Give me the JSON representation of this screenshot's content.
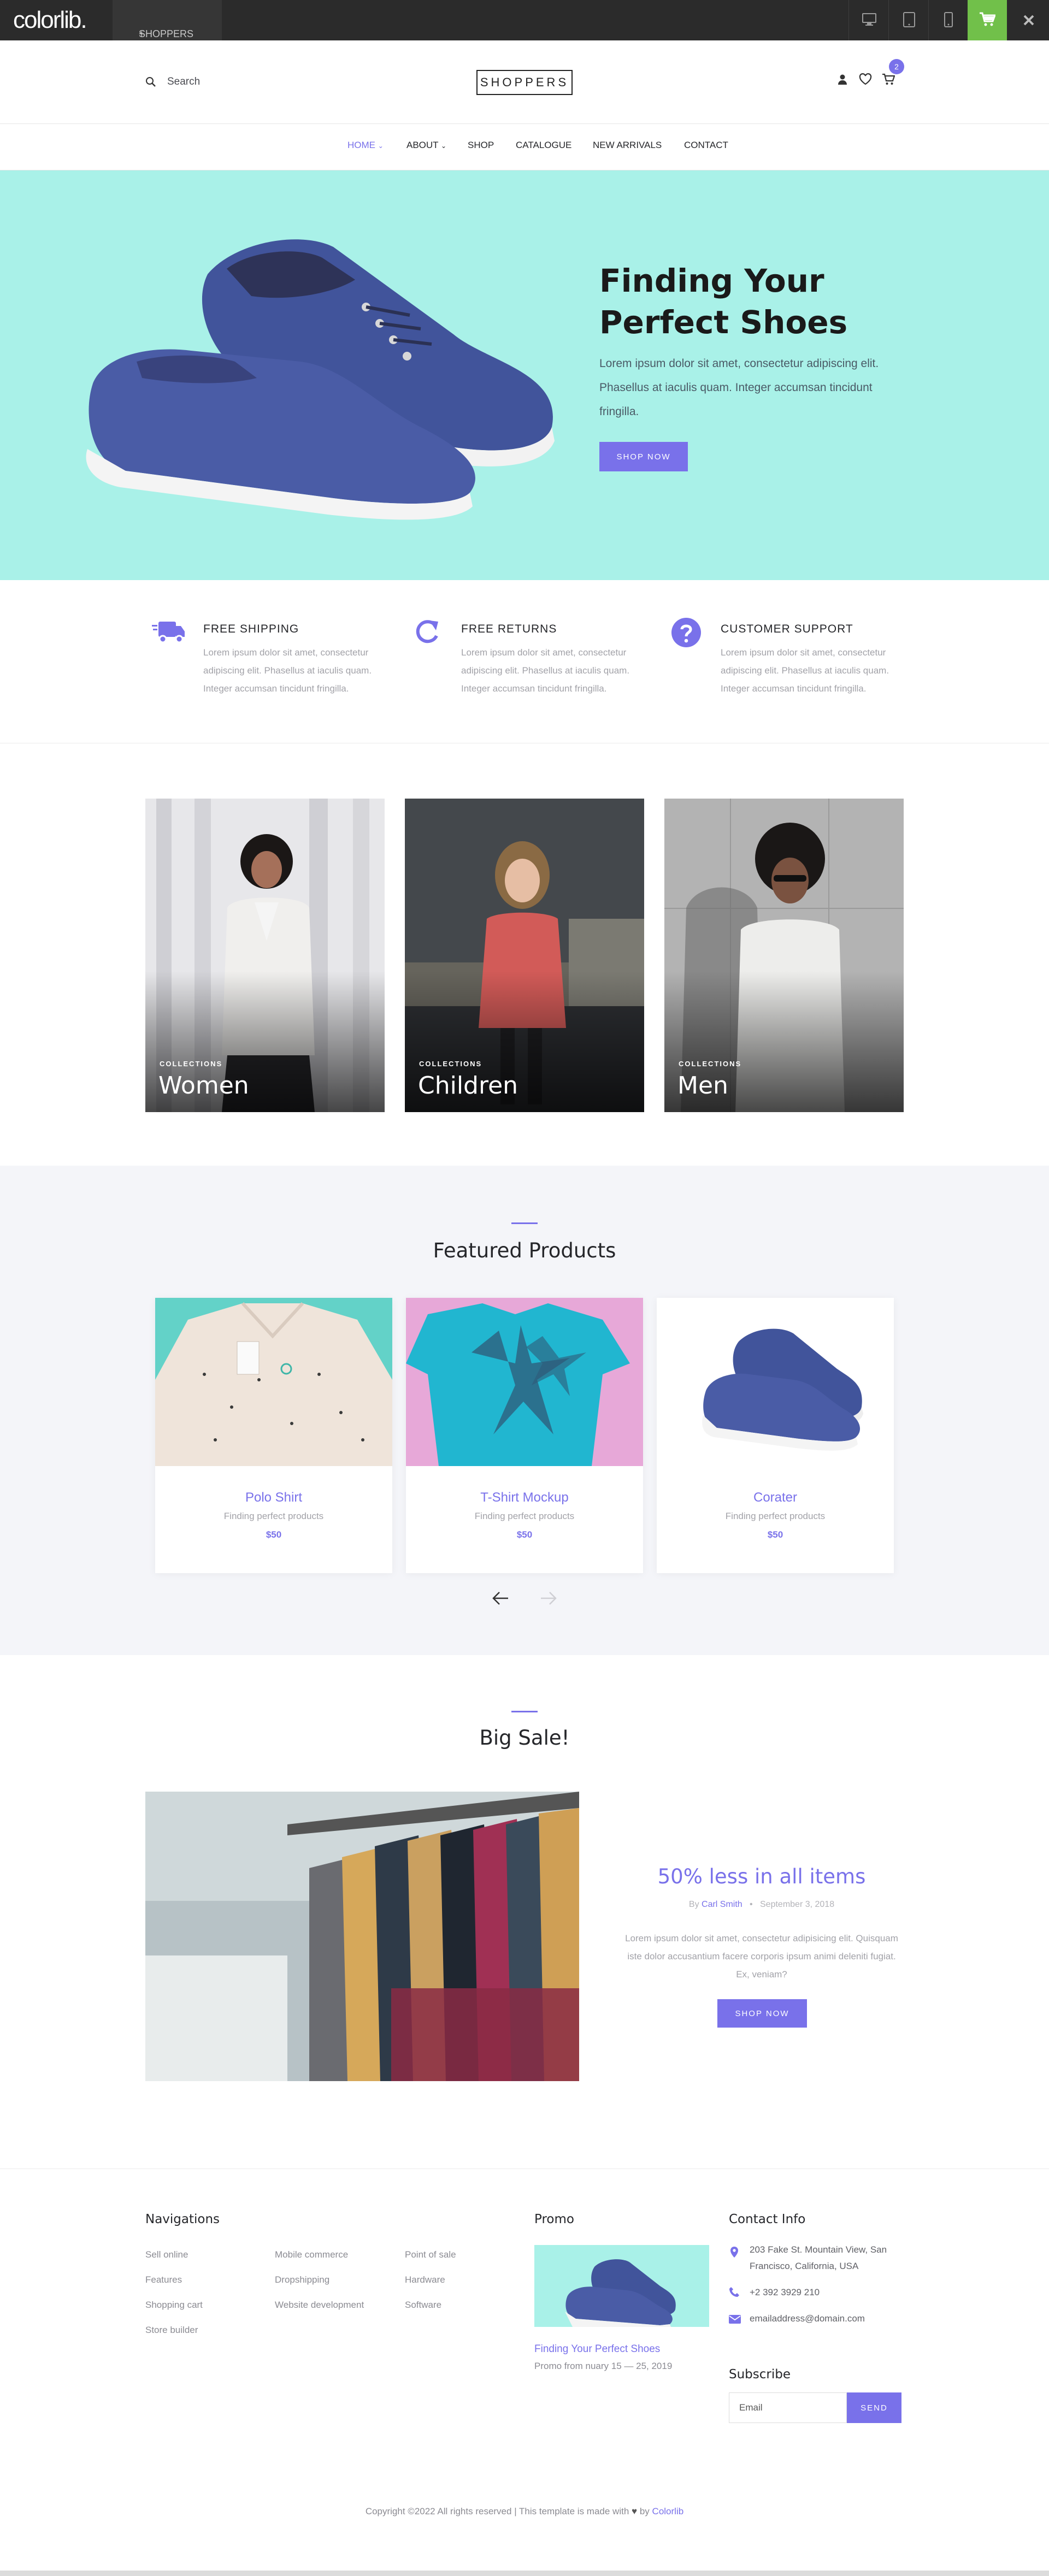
{
  "preview_bar": {
    "logo": "colorlib.",
    "template_name": "SHOPPERS",
    "devices": [
      "desktop-icon",
      "tablet-icon",
      "mobile-icon"
    ],
    "accent": "#71c04a"
  },
  "header": {
    "search_placeholder": "Search",
    "brand": "SHOPPERS",
    "cart_count": "2"
  },
  "nav": {
    "items": [
      {
        "label": "HOME",
        "dropdown": true,
        "active": true
      },
      {
        "label": "ABOUT",
        "dropdown": true,
        "active": false
      },
      {
        "label": "SHOP",
        "dropdown": false,
        "active": false
      },
      {
        "label": "CATALOGUE",
        "dropdown": false,
        "active": false
      },
      {
        "label": "NEW ARRIVALS",
        "dropdown": false,
        "active": false
      },
      {
        "label": "CONTACT",
        "dropdown": false,
        "active": false
      }
    ]
  },
  "hero": {
    "title_line1": "Finding Your",
    "title_line2": "Perfect Shoes",
    "text": "Lorem ipsum dolor sit amet, consectetur adipiscing elit. Phasellus at iaculis quam. Integer accumsan tincidunt fringilla.",
    "button": "SHOP NOW",
    "background": "#a9f1e8"
  },
  "features": [
    {
      "icon": "truck-icon",
      "title": "FREE SHIPPING",
      "text": "Lorem ipsum dolor sit amet, consectetur adipiscing elit. Phasellus at iaculis quam. Integer accumsan tincidunt fringilla."
    },
    {
      "icon": "refresh-icon",
      "title": "FREE RETURNS",
      "text": "Lorem ipsum dolor sit amet, consectetur adipiscing elit. Phasellus at iaculis quam. Integer accumsan tincidunt fringilla."
    },
    {
      "icon": "help-icon",
      "title": "CUSTOMER SUPPORT",
      "text": "Lorem ipsum dolor sit amet, consectetur adipiscing elit. Phasellus at iaculis quam. Integer accumsan tincidunt fringilla."
    }
  ],
  "collections": [
    {
      "kicker": "COLLECTIONS",
      "name": "Women"
    },
    {
      "kicker": "COLLECTIONS",
      "name": "Children"
    },
    {
      "kicker": "COLLECTIONS",
      "name": "Men"
    }
  ],
  "featured": {
    "title": "Featured Products",
    "products": [
      {
        "name": "Polo Shirt",
        "subtitle": "Finding perfect products",
        "price": "$50"
      },
      {
        "name": "T-Shirt Mockup",
        "subtitle": "Finding perfect products",
        "price": "$50"
      },
      {
        "name": "Corater",
        "subtitle": "Finding perfect products",
        "price": "$50"
      }
    ]
  },
  "sale": {
    "title": "Big Sale!",
    "headline": "50% less in all items",
    "by": "By",
    "author": "Carl Smith",
    "bullet": "•",
    "date": "September 3, 2018",
    "text": "Lorem ipsum dolor sit amet, consectetur adipisicing elit. Quisquam iste dolor accusantium facere corporis ipsum animi deleniti fugiat. Ex, veniam?",
    "button": "SHOP NOW"
  },
  "footer": {
    "nav_title": "Navigations",
    "nav_col1": [
      "Sell online",
      "Features",
      "Shopping cart",
      "Store builder"
    ],
    "nav_col2": [
      "Mobile commerce",
      "Dropshipping",
      "Website development"
    ],
    "nav_col3": [
      "Point of sale",
      "Hardware",
      "Software"
    ],
    "promo_title": "Promo",
    "promo_link": "Finding Your Perfect Shoes",
    "promo_date": "Promo from nuary 15 — 25, 2019",
    "contact_title": "Contact Info",
    "address": "203 Fake St. Mountain View, San Francisco, California, USA",
    "phone": "+2 392 3929 210",
    "email": "emailaddress@domain.com",
    "subscribe_title": "Subscribe",
    "email_placeholder": "Email",
    "send": "SEND",
    "copyright_prefix": "Copyright ©2022 All rights reserved | This template is made with",
    "copyright_by": "by",
    "copyright_link": "Colorlib"
  }
}
